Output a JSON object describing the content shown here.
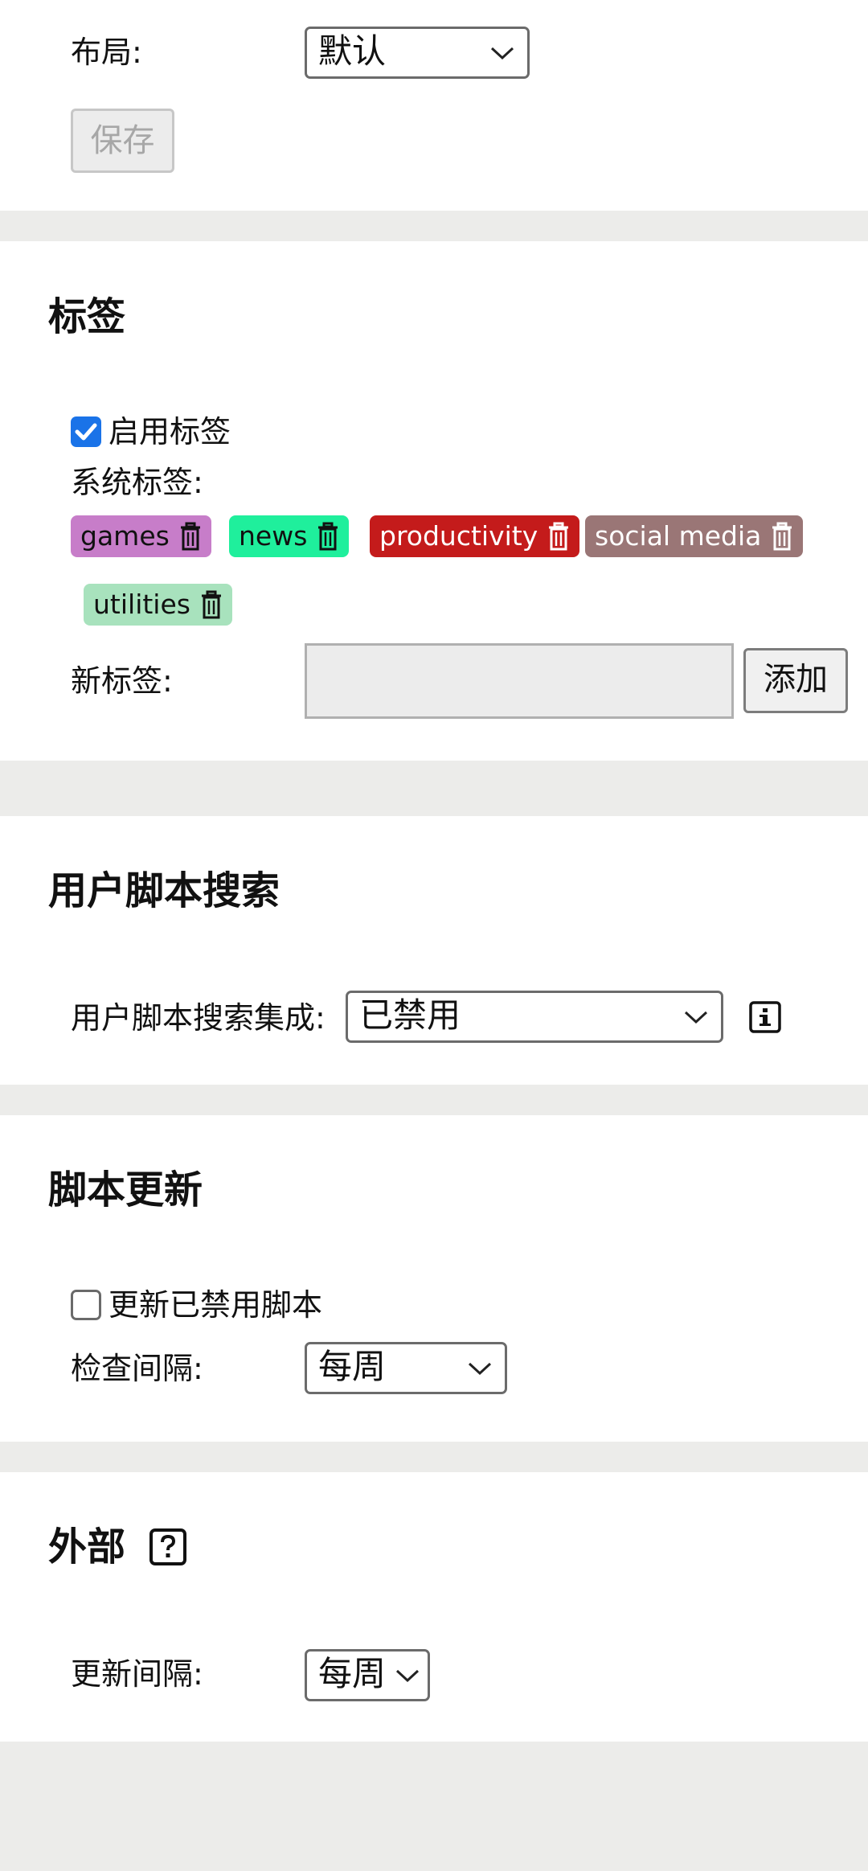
{
  "layout": {
    "label": "布局:",
    "selected": "默认",
    "save_label": "保存"
  },
  "tags": {
    "heading": "标签",
    "enable_label": "启用标签",
    "enable_checked": true,
    "system_tags_label": "系统标签:",
    "items": [
      {
        "name": "games",
        "color": "#c77dc9",
        "text_color": "#111111"
      },
      {
        "name": "news",
        "color": "#1fef9c",
        "text_color": "#111111"
      },
      {
        "name": "productivity",
        "color": "#c41b1b",
        "text_color": "#ffffff"
      },
      {
        "name": "social media",
        "color": "#9a7676",
        "text_color": "#ffffff"
      },
      {
        "name": "utilities",
        "color": "#a8e2bd",
        "text_color": "#111111"
      }
    ],
    "new_tag_label": "新标签:",
    "new_tag_value": "",
    "add_label": "添加",
    "trash_icon": "trash-icon"
  },
  "userscript_search": {
    "heading": "用户脚本搜索",
    "label": "用户脚本搜索集成:",
    "selected": "已禁用",
    "info_icon": "info-icon"
  },
  "script_update": {
    "heading": "脚本更新",
    "update_disabled_label": "更新已禁用脚本",
    "update_disabled_checked": false,
    "interval_label": "检查间隔:",
    "interval_selected": "每周"
  },
  "external": {
    "heading": "外部",
    "help_icon": "help-icon",
    "interval_label": "更新间隔:",
    "interval_selected": "每周"
  }
}
